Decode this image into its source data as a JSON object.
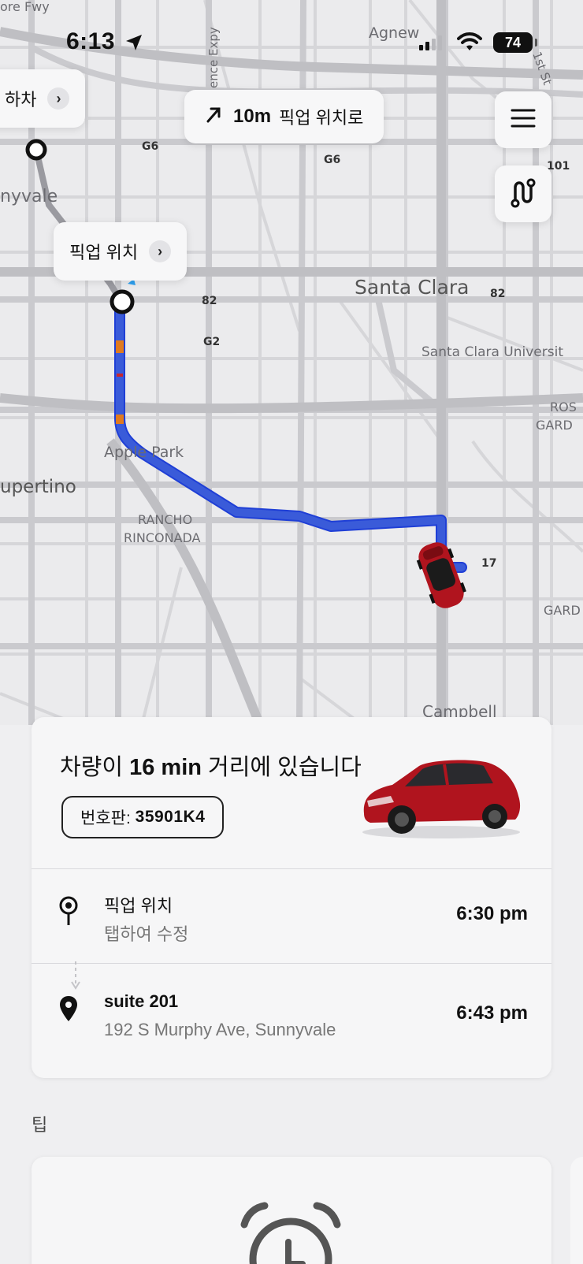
{
  "status_bar": {
    "time": "6:13",
    "battery": "74"
  },
  "map": {
    "labels": {
      "agnew": "Agnew",
      "sunnyvale": "nyvale",
      "santa_clara": "Santa Clara",
      "santa_clara_university": "Santa Clara Universit",
      "apple_park": "Apple Park",
      "cupertino": "upertino",
      "rancho": "RANCHO",
      "rinconada": "RINCONADA",
      "rose": "ROS",
      "garden": "GARD",
      "garden2": "GARD",
      "campbell": "Campbell",
      "fwy": "ore Fwy",
      "expy": "ence Expy",
      "first_st": "1st St",
      "r_g6a": "G6",
      "r_g6b": "G6",
      "r_82a": "82",
      "r_82b": "82",
      "r_g2": "G2",
      "r_101": "101",
      "r_17": "17"
    },
    "dropoff_chip": "하차",
    "pickup_chip": "픽업 위치",
    "nav_distance": "10m",
    "nav_text": "픽업 위치로"
  },
  "trip_card": {
    "eta_prefix": "차량이",
    "eta_value": "16 min",
    "eta_suffix": "거리에 있습니다",
    "plate_label": "번호판:",
    "plate_number": "35901K4",
    "pickup": {
      "title": "픽업 위치",
      "subtitle": "탭하여 수정",
      "time": "6:30 pm"
    },
    "dropoff": {
      "title": "suite 201",
      "address": "192 S Murphy Ave, Sunnyvale",
      "time": "6:43 pm"
    }
  },
  "tips": {
    "label": "팁"
  },
  "colors": {
    "route": "#3a5bd9",
    "traffic": "#e07a1f",
    "car": "#b0141e"
  }
}
